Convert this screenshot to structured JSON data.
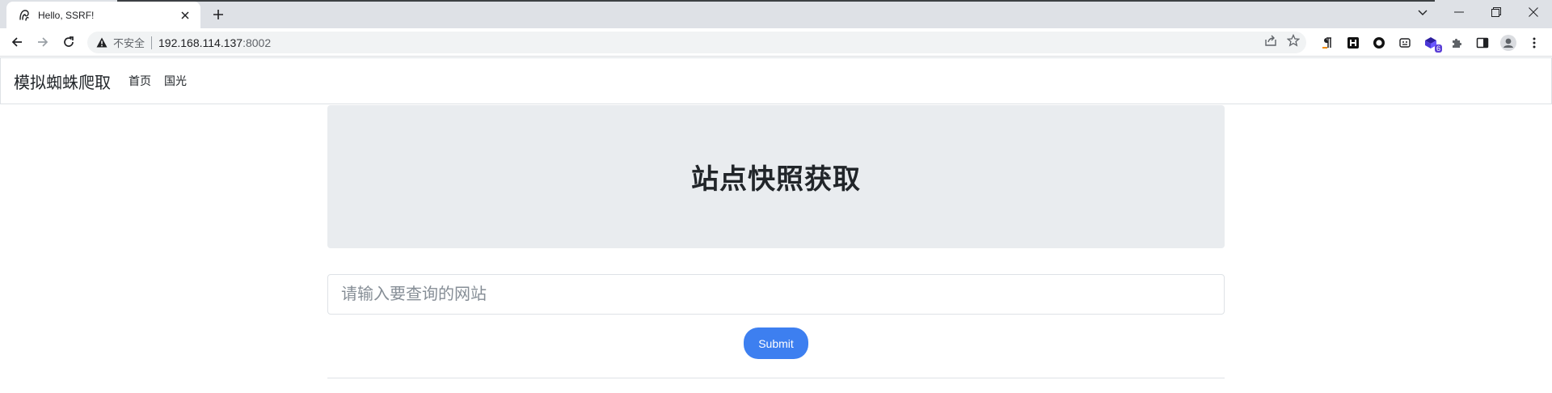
{
  "browser": {
    "tab_title": "Hello, SSRF!",
    "security_label": "不安全",
    "url_host": "192.168.114.137",
    "url_port": ":8002",
    "extensions": [
      {
        "icon": "paragraph-icon"
      },
      {
        "icon": "h-box-icon"
      },
      {
        "icon": "ring-icon"
      },
      {
        "icon": "screenshot-icon"
      },
      {
        "icon": "cube-icon",
        "badge": "6"
      },
      {
        "icon": "puzzle-icon"
      },
      {
        "icon": "sidepanel-icon"
      },
      {
        "icon": "profile-icon"
      },
      {
        "icon": "kebab-menu-icon"
      }
    ]
  },
  "navbar": {
    "brand": "模拟蜘蛛爬取",
    "links": [
      "首页",
      "国光"
    ]
  },
  "main": {
    "heading": "站点快照获取",
    "input_placeholder": "请输入要查询的网站",
    "submit_label": "Submit"
  },
  "colors": {
    "accent": "#3d7ff0",
    "jumbotron": "#e9ecef"
  }
}
